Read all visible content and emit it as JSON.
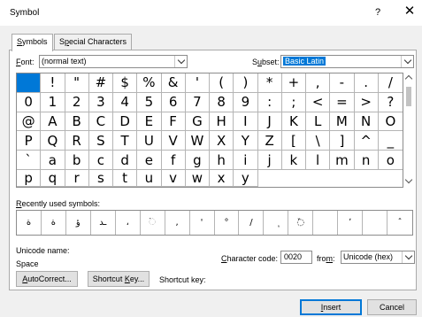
{
  "dialog": {
    "title": "Symbol",
    "help": "?",
    "close": "✕"
  },
  "tabs": [
    {
      "pre": "",
      "key": "S",
      "post": "ymbols"
    },
    {
      "pre": "S",
      "key": "p",
      "post": "ecial Characters"
    }
  ],
  "font": {
    "label_key": "F",
    "label_rest": "ont:",
    "value": "(normal text)"
  },
  "subset": {
    "label_pre": "S",
    "label_key": "u",
    "label_post": "bset:",
    "value": "Basic Latin"
  },
  "symbols": [
    " ",
    "!",
    "\"",
    "#",
    "$",
    "%",
    "&",
    "'",
    "(",
    ")",
    "*",
    "+",
    ",",
    "-",
    ".",
    "/",
    "0",
    "1",
    "2",
    "3",
    "4",
    "5",
    "6",
    "7",
    "8",
    "9",
    ":",
    ";",
    "<",
    "=",
    ">",
    "?",
    "@",
    "A",
    "B",
    "C",
    "D",
    "E",
    "F",
    "G",
    "H",
    "I",
    "J",
    "K",
    "L",
    "M",
    "N",
    "O",
    "P",
    "Q",
    "R",
    "S",
    "T",
    "U",
    "V",
    "W",
    "X",
    "Y",
    "Z",
    "[",
    "\\",
    "]",
    "^",
    "_",
    "`",
    "a",
    "b",
    "c",
    "d",
    "e",
    "f",
    "g",
    "h",
    "i",
    "j",
    "k",
    "l",
    "m",
    "n",
    "o",
    "p",
    "q",
    "r",
    "s",
    "t",
    "u",
    "v",
    "w",
    "x",
    "y"
  ],
  "recent": {
    "label_key": "R",
    "label_rest": "ecently used symbols:",
    "items": [
      "ة",
      "ة",
      "ؤ",
      "ـد",
      "،",
      "◌ٙ",
      ",",
      "'",
      "°",
      "/",
      "ٖ",
      "◌ٚ",
      "",
      "ʼ",
      "",
      "ˆ"
    ]
  },
  "unicode": {
    "label": "Unicode name:",
    "value": "Space"
  },
  "charcode": {
    "label_pre": "",
    "label_key": "C",
    "label_post": "haracter code:",
    "value": "0020"
  },
  "from": {
    "label_pre": "fro",
    "label_key": "m",
    "label_post": ":",
    "value": "Unicode (hex)"
  },
  "buttons": {
    "autocorrect_key": "A",
    "autocorrect_rest": "utoCorrect...",
    "shortcut_pre": "Shortcut ",
    "shortcut_key": "K",
    "shortcut_post": "ey...",
    "shortcut_label": "Shortcut key:",
    "insert_key": "I",
    "insert_rest": "nsert",
    "cancel": "Cancel"
  }
}
